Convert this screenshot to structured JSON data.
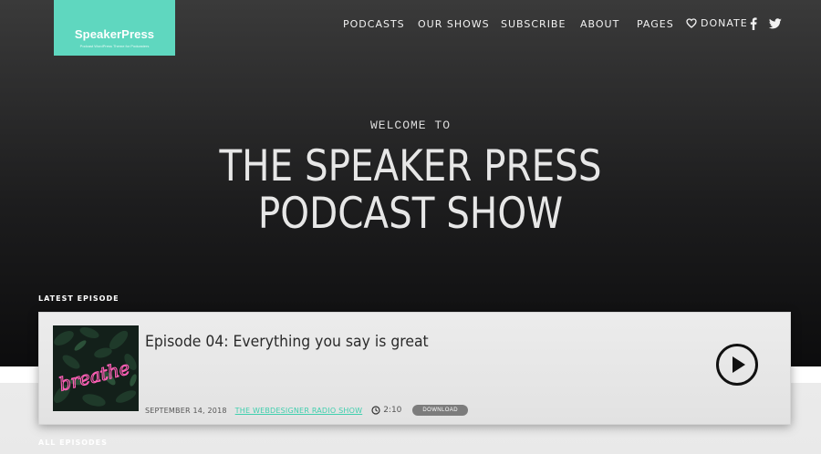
{
  "brand": {
    "name": "SpeakerPress",
    "tagline": "Podcast WordPress Theme for Podcasters",
    "accent": "#5fd7bf"
  },
  "nav": {
    "items": [
      "PODCASTS",
      "OUR SHOWS",
      "SUBSCRIBE",
      "ABOUT",
      "PAGES"
    ],
    "donate": "DONATE",
    "social": [
      "facebook-icon",
      "twitter-icon"
    ]
  },
  "hero": {
    "welcome": "WELCOME TO",
    "title_line1": "THE SPEAKER PRESS",
    "title_line2": "PODCAST SHOW"
  },
  "latest": {
    "label": "LATEST EPISODE",
    "episode": {
      "title": "Episode 04: Everything you say is great",
      "art_text": "breathe",
      "date": "SEPTEMBER 14, 2018",
      "show": "THE WEBDESIGNER RADIO SHOW",
      "duration": "2:10",
      "download": "DOWNLOAD"
    }
  },
  "all": {
    "label": "ALL EPISODES"
  }
}
